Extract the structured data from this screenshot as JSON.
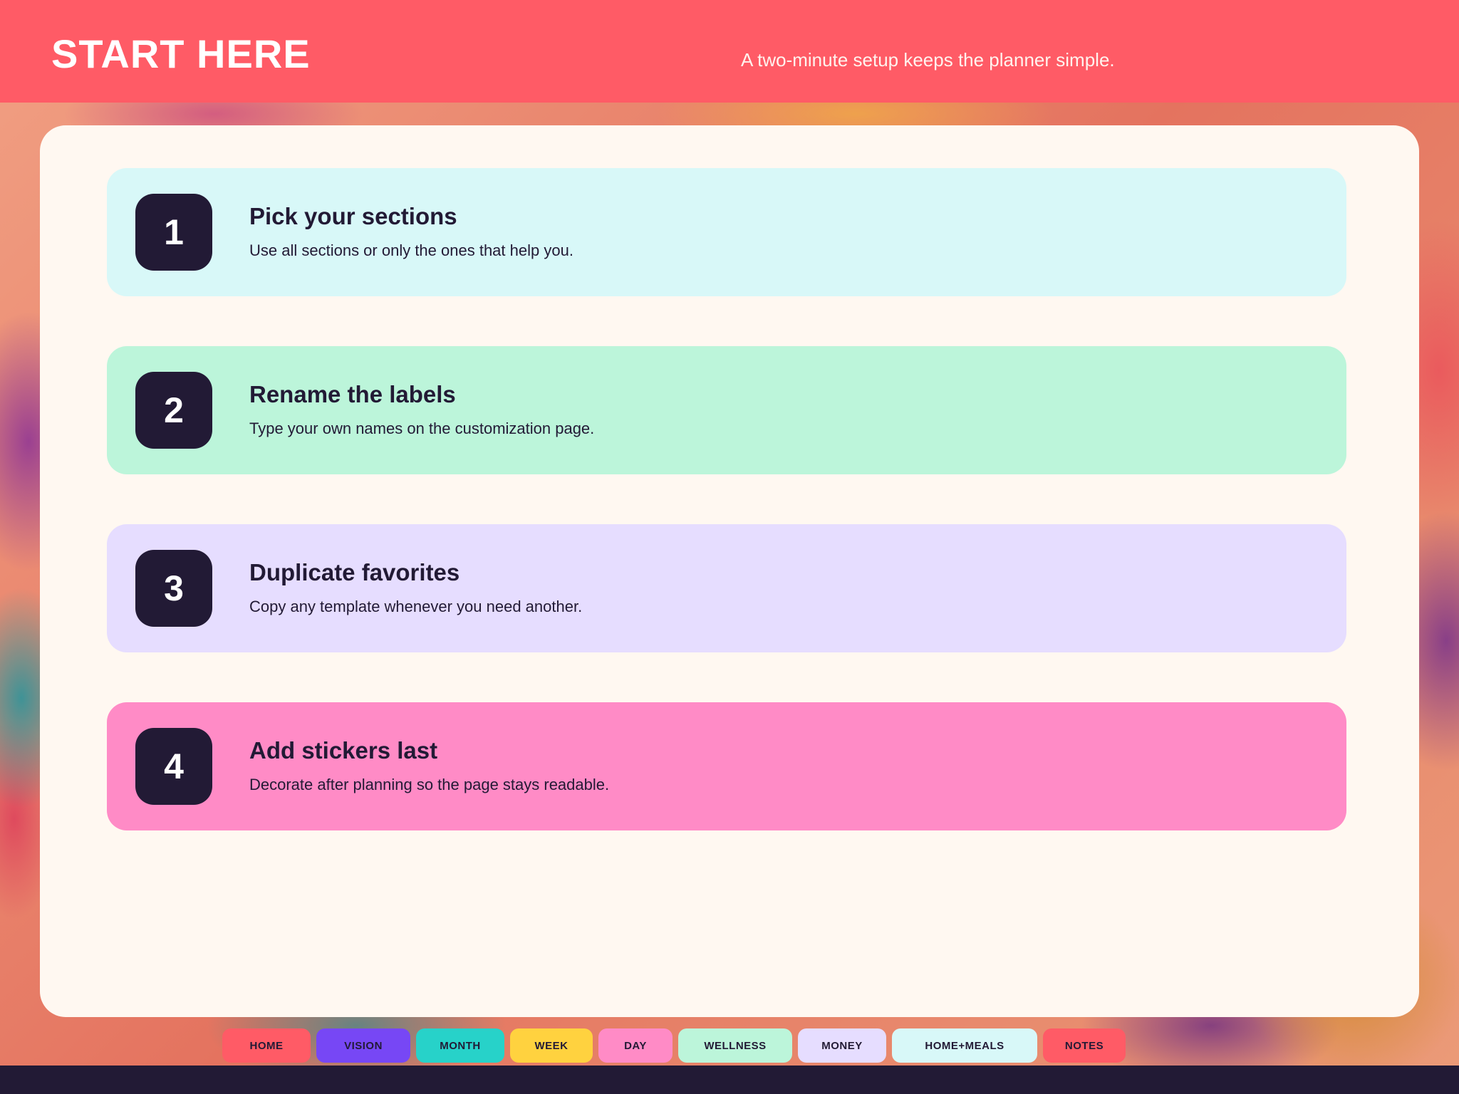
{
  "header": {
    "title": "START HERE",
    "tagline": "A two-minute setup keeps the planner simple."
  },
  "steps": [
    {
      "number": "1",
      "title": "Pick your sections",
      "description": "Use all sections or only the ones that help you.",
      "color": "#d8f8f8"
    },
    {
      "number": "2",
      "title": "Rename the labels",
      "description": "Type your own names on the customization page.",
      "color": "#bcf5da"
    },
    {
      "number": "3",
      "title": "Duplicate favorites",
      "description": "Copy any template whenever you need another.",
      "color": "#e6ddff"
    },
    {
      "number": "4",
      "title": "Add stickers last",
      "description": "Decorate after planning so the page stays readable.",
      "color": "#ff8bc6"
    }
  ],
  "nav": {
    "tabs": [
      {
        "label": "HOME",
        "color": "#ff5b66"
      },
      {
        "label": "VISION",
        "color": "#7747f5"
      },
      {
        "label": "MONTH",
        "color": "#27d2c9"
      },
      {
        "label": "WEEK",
        "color": "#ffd23f"
      },
      {
        "label": "DAY",
        "color": "#ff8bc6"
      },
      {
        "label": "WELLNESS",
        "color": "#bcf5da"
      },
      {
        "label": "MONEY",
        "color": "#e6ddff"
      },
      {
        "label": "HOME+MEALS",
        "color": "#d8f8f8"
      },
      {
        "label": "NOTES",
        "color": "#ff5b66"
      }
    ]
  },
  "colors": {
    "header_bg": "#ff5b66",
    "panel_bg": "#fff8f1",
    "dark": "#221a35"
  }
}
